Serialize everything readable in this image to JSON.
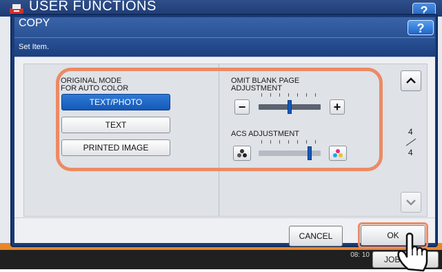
{
  "background": {
    "header_title": "USER FUNCTIONS",
    "help_label": "?",
    "clock_line1": "",
    "clock_line2": "08: 10",
    "job_status_label": "JOB S"
  },
  "dialog": {
    "title": "COPY",
    "help_label": "?",
    "subtitle": "Set Item.",
    "original_mode": {
      "label_line1": "ORIGINAL MODE",
      "label_line2": "FOR AUTO COLOR",
      "options": [
        "TEXT/PHOTO",
        "TEXT",
        "PRINTED IMAGE"
      ],
      "selected": "TEXT/PHOTO"
    },
    "omit_blank_page": {
      "label_line1": "OMIT BLANK PAGE",
      "label_line2": "ADJUSTMENT",
      "minus_label": "−",
      "plus_label": "+",
      "level_fraction": 0.5
    },
    "acs_adjustment": {
      "label": "ACS ADJUSTMENT",
      "level_fraction": 0.85
    },
    "pager": {
      "current": "4",
      "total": "4"
    },
    "cancel_label": "CANCEL",
    "ok_label": "OK"
  },
  "colors": {
    "accent_blue": "#1559b8",
    "highlight_orange": "#ec8a64",
    "dialog_frame": "#1a3b78"
  },
  "icons": {
    "up": "chevron-up-icon",
    "down": "chevron-down-icon",
    "mono_dots": "monochrome-dots-icon",
    "color_dots": "color-dots-icon",
    "pointer": "hand-pointer-icon"
  }
}
